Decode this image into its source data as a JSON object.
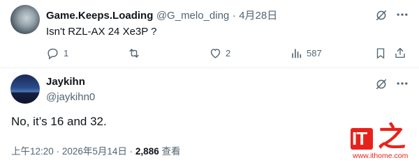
{
  "reply_tweet": {
    "display_name": "Game.Keeps.Loading",
    "handle": "@G_melo_ding",
    "separator": "·",
    "date": "4月28日",
    "text": "Isn't RZL-AX 24 Xe3P ?",
    "actions": {
      "reply_count": "1",
      "retweet_count": "",
      "like_count": "2",
      "views_count": "587"
    }
  },
  "main_tweet": {
    "display_name": "Jaykihn",
    "handle": "@jaykihn0",
    "text": "No, it’s 16 and 32.",
    "time": "上午12:20",
    "date": "2026年5月14日",
    "separator": "·",
    "views_count": "2,886",
    "views_label": "查看"
  },
  "watermark": {
    "logo_text": "IT",
    "logo_char": "之",
    "url": "www.ithome.com",
    "brand_color": "#e8221a"
  },
  "colors": {
    "text": "#0f1419",
    "muted": "#536471",
    "divider": "#eff3f4"
  }
}
